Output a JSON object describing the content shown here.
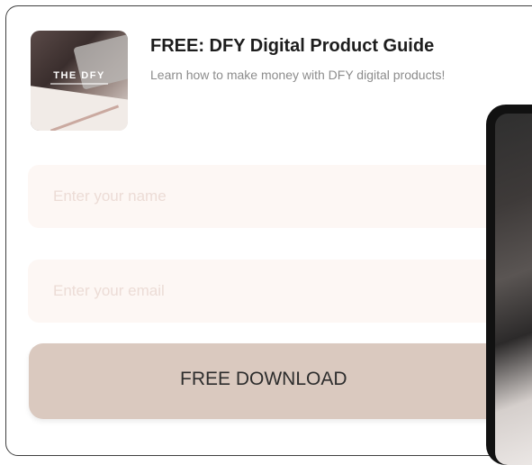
{
  "product": {
    "thumbnail_text": "THE DFY",
    "title": "FREE: DFY Digital Product Guide",
    "subtitle": "Learn how to make money with DFY digital products!"
  },
  "form": {
    "name_placeholder": "Enter your name",
    "email_placeholder": "Enter your email",
    "submit_label": "FREE DOWNLOAD"
  },
  "colors": {
    "field_background": "#fdf7f4",
    "button_background": "#dac9bf",
    "placeholder_text": "#ecdcd6"
  }
}
